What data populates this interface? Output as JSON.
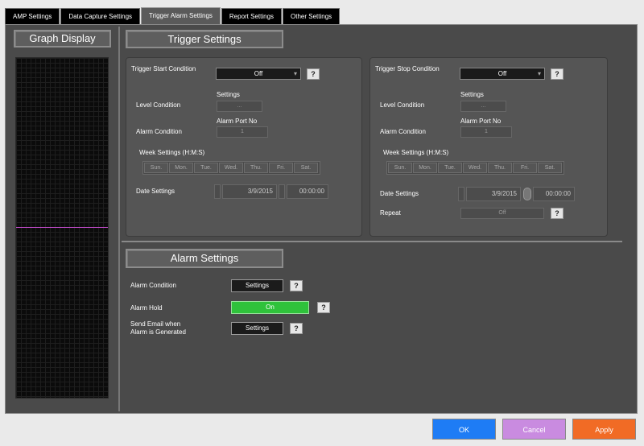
{
  "tabs": [
    "AMP Settings",
    "Data Capture Settings",
    "Trigger Alarm Settings",
    "Report Settings",
    "Other Settings"
  ],
  "active_tab": "Trigger Alarm Settings",
  "graph": {
    "title": "Graph Display"
  },
  "trigger": {
    "title": "Trigger Settings",
    "start": {
      "condition_label": "Trigger Start Condition",
      "condition_value": "Off",
      "help": "?",
      "level_label": "Level Condition",
      "settings_label": "Settings",
      "settings_value": "...",
      "alarm_condition_label": "Alarm Condition",
      "alarm_port_label": "Alarm Port No",
      "alarm_port_value": "1",
      "week_label": "Week Settings (H:M:S)",
      "days": [
        "Sun.",
        "Mon.",
        "Tue.",
        "Wed.",
        "Thu.",
        "Fri.",
        "Sat."
      ],
      "date_label": "Date Settings",
      "date_value": "3/9/2015",
      "time_value": "00:00:00"
    },
    "stop": {
      "condition_label": "Trigger Stop Condition",
      "condition_value": "Off",
      "help": "?",
      "level_label": "Level Condition",
      "settings_label": "Settings",
      "settings_value": "...",
      "alarm_condition_label": "Alarm Condition",
      "alarm_port_label": "Alarm Port No",
      "alarm_port_value": "1",
      "week_label": "Week Settings (H:M:S)",
      "days": [
        "Sun.",
        "Mon.",
        "Tue.",
        "Wed.",
        "Thu.",
        "Fri.",
        "Sat."
      ],
      "date_label": "Date Settings",
      "date_value": "3/9/2015",
      "time_value": "00:00:00",
      "repeat_label": "Repeat",
      "repeat_value": "Off",
      "help2": "?"
    }
  },
  "alarm": {
    "title": "Alarm Settings",
    "condition_label": "Alarm Condition",
    "condition_button": "Settings",
    "hold_label": "Alarm Hold",
    "hold_value": "On",
    "email_label_1": "Send Email when",
    "email_label_2": "Alarm is Generated",
    "email_button": "Settings",
    "help": "?"
  },
  "buttons": {
    "ok": "OK",
    "cancel": "Cancel",
    "apply": "Apply"
  },
  "colors": {
    "ok": "#1e7cf5",
    "cancel": "#c98be0",
    "apply": "#f16b25",
    "on_green": "#2fc23b"
  }
}
